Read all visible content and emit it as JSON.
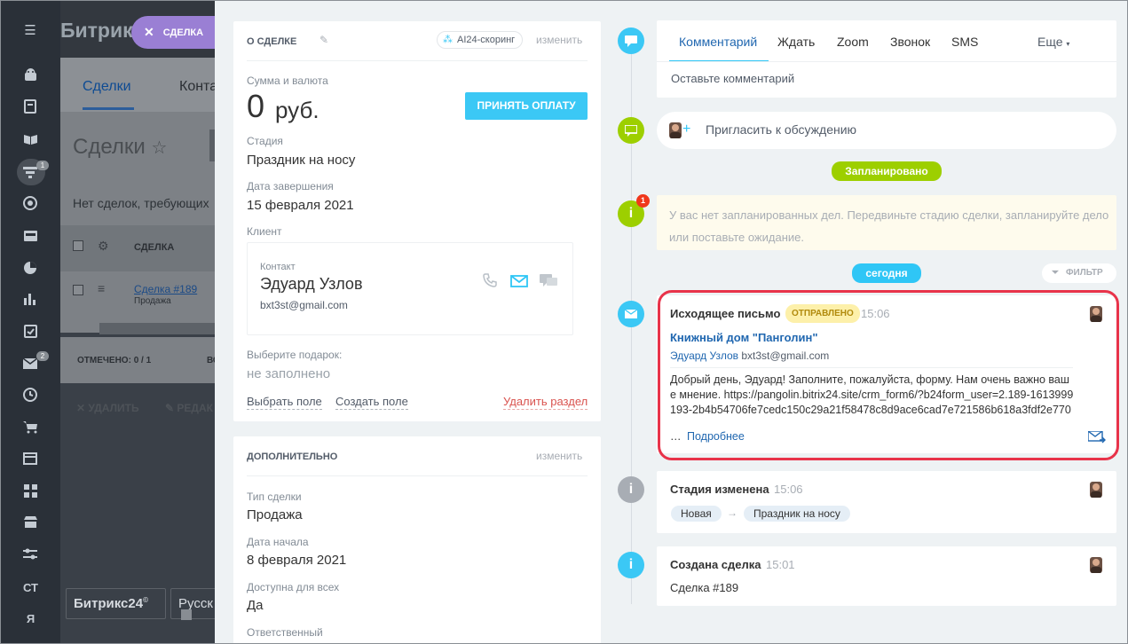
{
  "rail": {
    "badges": [
      "1",
      "2"
    ],
    "bottom": [
      "СТ",
      "Я"
    ]
  },
  "background": {
    "title": "Битрик",
    "tabs": [
      "Сделки",
      "Конта"
    ],
    "heading": "Сделки",
    "note": "Нет сделок, требующих",
    "table": {
      "col_deal": "СДЕЛКА",
      "deal_link": "Сделка #189",
      "deal_sub": "Продажа"
    },
    "marked": "ОТМЕЧЕНО: 0 / 1",
    "marked2": "ВС",
    "actions": {
      "delete": "УДАЛИТЬ",
      "edit": "РЕДАК"
    },
    "footer": {
      "brand": "Битрикс24",
      "brand_mark": "©",
      "lang": "Русск"
    }
  },
  "close_pill": {
    "label": "СДЕЛКА"
  },
  "about": {
    "title": "О СДЕЛКЕ",
    "scoring": "AI24-скоринг",
    "edit": "изменить",
    "amount_label": "Сумма и валюта",
    "amount_value": "0",
    "amount_currency": "руб.",
    "pay_button": "ПРИНЯТЬ ОПЛАТУ",
    "stage_label": "Стадия",
    "stage_value": "Праздник на носу",
    "close_date_label": "Дата завершения",
    "close_date_value": "15 февраля 2021",
    "client_label": "Клиент",
    "contact": {
      "label": "Контакт",
      "name": "Эдуард Узлов",
      "email": "bxt3st@gmail.com"
    },
    "gift_label": "Выберите подарок:",
    "gift_value": "не заполнено",
    "select_field": "Выбрать поле",
    "create_field": "Создать поле",
    "delete_section": "Удалить раздел"
  },
  "extra": {
    "title": "ДОПОЛНИТЕЛЬНО",
    "edit": "изменить",
    "type_label": "Тип сделки",
    "type_value": "Продажа",
    "start_label": "Дата начала",
    "start_value": "8 февраля 2021",
    "access_label": "Доступна для всех",
    "access_value": "Да",
    "resp_label": "Ответственный"
  },
  "composer": {
    "tabs": [
      "Комментарий",
      "Ждать",
      "Zoom",
      "Звонок",
      "SMS"
    ],
    "more": "Еще",
    "placeholder": "Оставьте комментарий"
  },
  "invite": {
    "label": "Пригласить к обсуждению"
  },
  "planned": {
    "badge": "Запланировано",
    "count": "1",
    "text": "У вас нет запланированных дел. Передвиньте стадию сделки, запланируйте дело или поставьте ожидание."
  },
  "today": {
    "badge": "сегодня",
    "filter": "ФИЛЬТР"
  },
  "email": {
    "title": "Исходящее письмо",
    "status": "ОТПРАВЛЕНО",
    "time": "15:06",
    "subject": "Книжный дом \"Панголин\"",
    "from_name": "Эдуард Узлов",
    "from_email": "bxt3st@gmail.com",
    "body": "Добрый день, Эдуард! Заполните, пожалуйста, форму. Нам очень важно ваше мнение. https://pangolin.bitrix24.site/crm_form6/?b24form_user=2.189-1613999193-2b4b54706fe7cedc150c29a21f58478c8d9ace6cad7e721586b618a3fdf2e770",
    "ellipsis": "…",
    "more": "Подробнее"
  },
  "stage_change": {
    "title": "Стадия изменена",
    "time": "15:06",
    "from": "Новая",
    "to": "Праздник на носу"
  },
  "created": {
    "title": "Создана сделка",
    "time": "15:01",
    "text": "Сделка #189"
  }
}
